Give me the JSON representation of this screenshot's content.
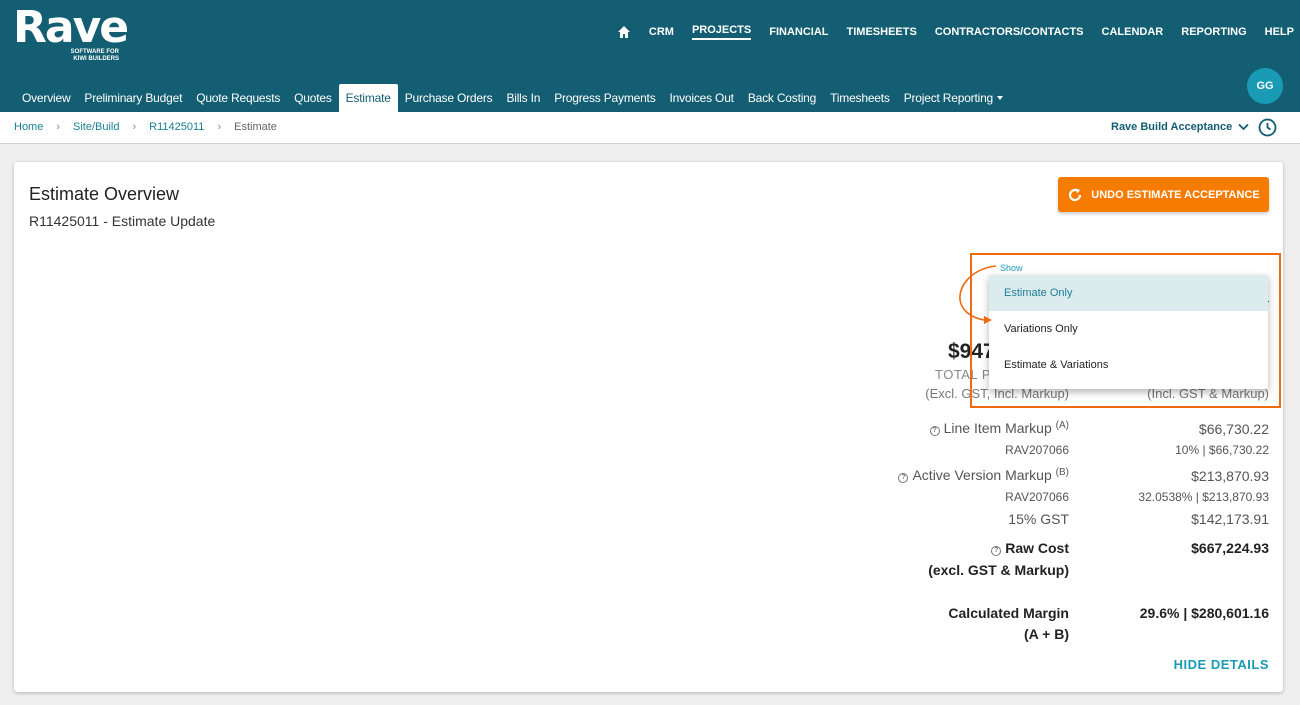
{
  "brand": {
    "name": "Rave",
    "tagline_line1": "SOFTWARE FOR",
    "tagline_line2": "KIWI BUILDERS"
  },
  "topnav": {
    "items": [
      "CRM",
      "PROJECTS",
      "FINANCIAL",
      "TIMESHEETS",
      "CONTRACTORS/CONTACTS",
      "CALENDAR",
      "REPORTING",
      "HELP"
    ],
    "active": "PROJECTS"
  },
  "user": {
    "initials": "GG"
  },
  "subnav": {
    "tabs": [
      "Overview",
      "Preliminary Budget",
      "Quote Requests",
      "Quotes",
      "Estimate",
      "Purchase Orders",
      "Bills In",
      "Progress Payments",
      "Invoices Out",
      "Back Costing",
      "Timesheets",
      "Project Reporting"
    ],
    "active": "Estimate"
  },
  "breadcrumb": {
    "items": [
      "Home",
      "Site/Build",
      "R11425011",
      "Estimate"
    ]
  },
  "acceptance_selector": {
    "value": "Rave Build Acceptance"
  },
  "card": {
    "title": "Estimate Overview",
    "subtitle": "R11425011 - Estimate Update",
    "undo_button": "UNDO ESTIMATE ACCEPTANCE"
  },
  "show_dropdown": {
    "label": "Show",
    "options": [
      "Estimate Only",
      "Variations Only",
      "Estimate & Variations"
    ],
    "selected": "Estimate Only"
  },
  "totals": {
    "big_total_partial": "$947",
    "total_label_partial": "TOTAL P",
    "excl_label": "(Excl. GST, Incl. Markup)",
    "incl_label": "(Incl. GST & Markup)"
  },
  "details": {
    "line_item_markup": {
      "label": "Line Item Markup",
      "sup": "(A)",
      "value": "$66,730.22",
      "code": "RAV207066",
      "sub_value": "10% | $66,730.22"
    },
    "active_version_markup": {
      "label": "Active Version Markup",
      "sup": "(B)",
      "value": "$213,870.93",
      "code": "RAV207066",
      "sub_value": "32.0538% | $213,870.93"
    },
    "gst": {
      "label": "15% GST",
      "value": "$142,173.91"
    },
    "raw_cost": {
      "label": "Raw Cost",
      "label2": "(excl. GST & Markup)",
      "value": "$667,224.93"
    },
    "calculated_margin": {
      "label": "Calculated Margin",
      "label2": "(A + B)",
      "value": "29.6% | $280,601.16"
    },
    "hide_details": "HIDE DETAILS"
  },
  "colors": {
    "header": "#135e72",
    "accent": "#f57c00",
    "link": "#1a9bb5"
  }
}
